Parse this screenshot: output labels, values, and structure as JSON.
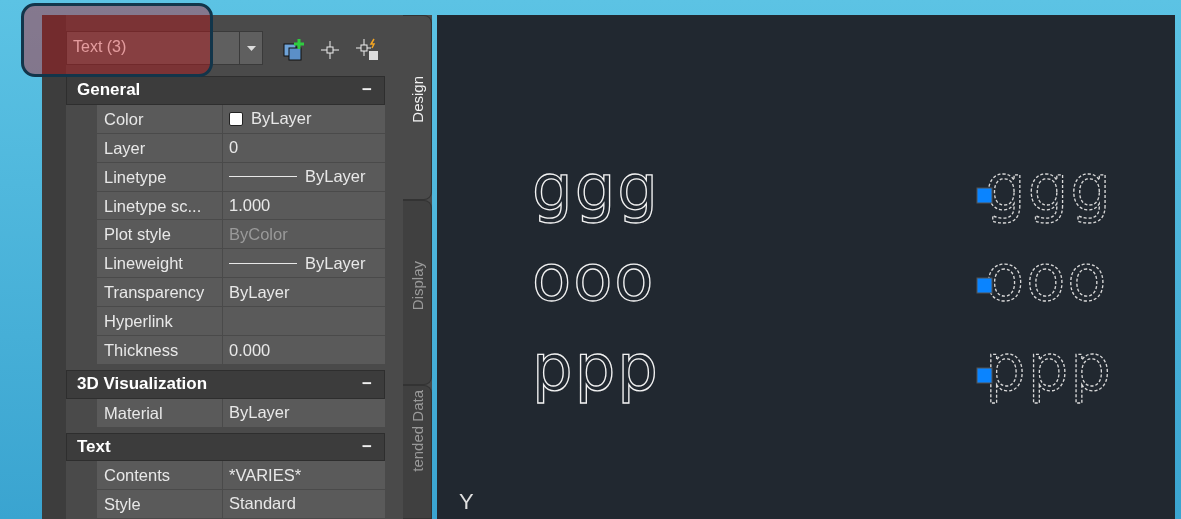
{
  "selection_dropdown": {
    "value": "Text (3)"
  },
  "sections": [
    {
      "title": "General",
      "toggle": "−",
      "rows": [
        {
          "label": "Color",
          "value": "ByLayer",
          "kind": "swatch"
        },
        {
          "label": "Layer",
          "value": "0",
          "kind": "plain"
        },
        {
          "label": "Linetype",
          "value": "ByLayer",
          "kind": "line"
        },
        {
          "label": "Linetype sc...",
          "value": "1.000",
          "kind": "plain"
        },
        {
          "label": "Plot style",
          "value": "ByColor",
          "kind": "plain",
          "disabled": true
        },
        {
          "label": "Lineweight",
          "value": "ByLayer",
          "kind": "line"
        },
        {
          "label": "Transparency",
          "value": "ByLayer",
          "kind": "plain"
        },
        {
          "label": "Hyperlink",
          "value": "",
          "kind": "plain"
        },
        {
          "label": "Thickness",
          "value": "0.000",
          "kind": "plain"
        }
      ]
    },
    {
      "title": "3D Visualization",
      "toggle": "−",
      "rows": [
        {
          "label": "Material",
          "value": "ByLayer",
          "kind": "plain"
        }
      ]
    },
    {
      "title": "Text",
      "toggle": "−",
      "rows": [
        {
          "label": "Contents",
          "value": "*VARIES*",
          "kind": "plain"
        },
        {
          "label": "Style",
          "value": "Standard",
          "kind": "plain"
        }
      ]
    }
  ],
  "tabs": [
    {
      "label": "Design",
      "selected": true
    },
    {
      "label": "Display",
      "selected": false
    },
    {
      "label": "tended Data",
      "selected": false
    }
  ],
  "canvas": {
    "text_objects": [
      {
        "text": "ggg",
        "selected": false
      },
      {
        "text": "ggg",
        "selected": true
      },
      {
        "text": "ooo",
        "selected": false
      },
      {
        "text": "ooo",
        "selected": true
      },
      {
        "text": "ppp",
        "selected": false
      },
      {
        "text": "ppp",
        "selected": true
      }
    ],
    "ucs_label": "Y"
  }
}
